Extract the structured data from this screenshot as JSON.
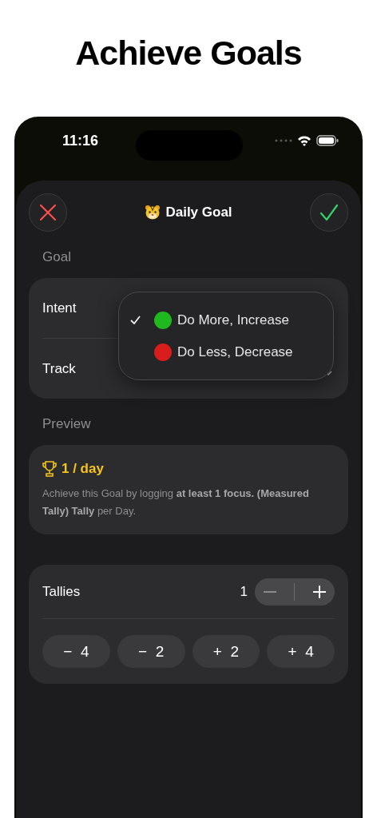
{
  "headline": "Achieve Goals",
  "status_bar": {
    "time": "11:16"
  },
  "sheet": {
    "title": "Daily Goal"
  },
  "goal_section": {
    "label": "Goal",
    "rows": [
      {
        "label": "Intent"
      },
      {
        "label": "Track"
      }
    ]
  },
  "intent_menu": [
    {
      "label": "Do More, Increase",
      "color": "#1fb81f",
      "selected": true
    },
    {
      "label": "Do Less, Decrease",
      "color": "#d91c1c",
      "selected": false
    }
  ],
  "preview_section": {
    "label": "Preview",
    "target": "1 / day",
    "description": "Achieve this Goal by logging **at least 1 focus. (Measured Tally) Tally** per Day."
  },
  "tallies": {
    "label": "Tallies",
    "value": "1",
    "quick_adjust": [
      {
        "sign": "−",
        "amount": "4"
      },
      {
        "sign": "−",
        "amount": "2"
      },
      {
        "sign": "+",
        "amount": "2"
      },
      {
        "sign": "+",
        "amount": "4"
      }
    ]
  }
}
